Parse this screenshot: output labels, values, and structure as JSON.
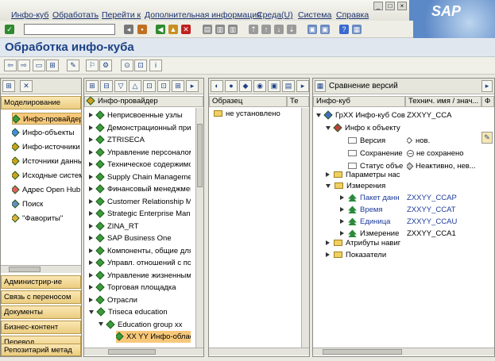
{
  "menu": [
    "Инфо-куб",
    "Обработать",
    "Перейти к",
    "Дополнительная информация",
    "Среда(U)",
    "Система",
    "Справка"
  ],
  "title": "Обработка инфо-куба",
  "left_nav": {
    "header_top": "Моделирование",
    "items": [
      "Инфо-провайдер",
      "Инфо-объекты",
      "Инфо-источники",
      "Источники данных",
      "Исходные системы",
      "Адрес Open Hub",
      "Поиск",
      "\"Фавориты\""
    ],
    "bottom": [
      "Администрир-ие",
      "Связь с переносом",
      "Документы",
      "Бизнес-контент",
      "Перевод",
      "Репозитарий метад"
    ]
  },
  "tree": {
    "header": "Инфо-провайдер",
    "items": [
      "Неприсвоенные узлы",
      "Демонстрационный приме",
      "ZTRISECA",
      "Управление персоналом",
      "Техническое содержимое",
      "Supply Chain Management",
      "Финансовый менеджмент",
      "Customer Relationship Man",
      "Strategic Enterprise Manage",
      "ZINA_RT",
      "SAP Business One",
      "Компоненты, общие для вс",
      "Управл. отношений с поста",
      "Управление жизненным ц",
      "Торговая площадка",
      "Отрасли",
      "Triseca education",
      "Education group xx",
      "XX YY Инфо-област"
    ]
  },
  "template": {
    "col1": "Образец",
    "col2": "Те",
    "row": "не установлено"
  },
  "detail": {
    "header": "Сравнение версий",
    "col1": "Инфо-куб",
    "col2": "Технич. имя / знач...",
    "col3": "Ф",
    "rows": [
      {
        "a": "ГрХХ Инфо-куб Сов",
        "b": "ZXXYY_CCA"
      },
      {
        "a": "Инфо к объекту",
        "b": ""
      },
      {
        "a": "Версия",
        "b": "нов."
      },
      {
        "a": "Сохранение",
        "b": "не сохранено"
      },
      {
        "a": "Статус объе",
        "b": "Неактивно, нев..."
      },
      {
        "a": "Параметры нас",
        "b": ""
      },
      {
        "a": "Измерения",
        "b": ""
      },
      {
        "a": "Пакет данн",
        "b": "ZXXYY_CCAP"
      },
      {
        "a": "Время",
        "b": "ZXXYY_CCAT"
      },
      {
        "a": "Единица",
        "b": "ZXXYY_CCAU"
      },
      {
        "a": "Измерение",
        "b": "ZXXYY_CCA1"
      },
      {
        "a": "Атрибуты навиг",
        "b": ""
      },
      {
        "a": "Показатели",
        "b": ""
      }
    ]
  },
  "sap_logo": "SAP"
}
